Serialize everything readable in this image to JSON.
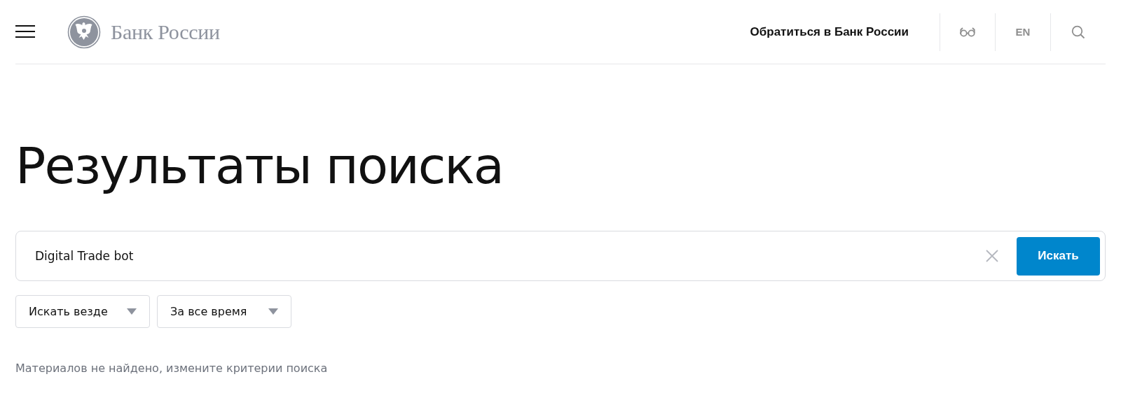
{
  "header": {
    "logo_text": "Банк России",
    "contact_link": "Обратиться в Банк России",
    "language": "EN"
  },
  "title": "Результаты поиска",
  "search": {
    "value": "Digital Trade bot",
    "button": "Искать"
  },
  "filters": [
    {
      "label": "Искать везде"
    },
    {
      "label": "За все время"
    }
  ],
  "message": "Материалов не найдено, измените критерии поиска"
}
